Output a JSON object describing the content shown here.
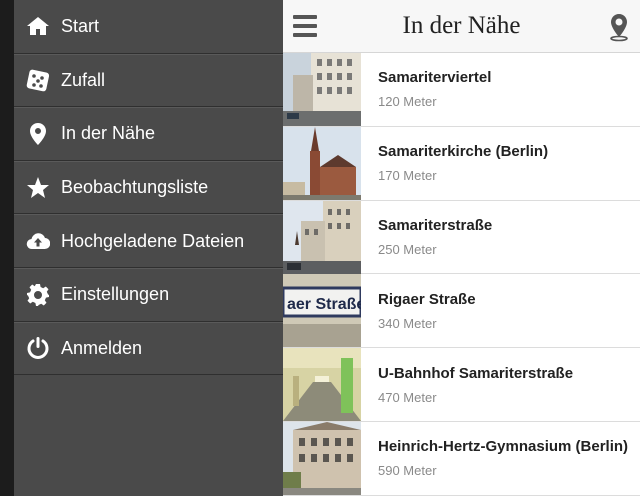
{
  "drawer": {
    "items": [
      {
        "label": "Start",
        "icon": "home-icon"
      },
      {
        "label": "Zufall",
        "icon": "dice-icon"
      },
      {
        "label": "In der Nähe",
        "icon": "location-pin-icon"
      },
      {
        "label": "Beobachtungsliste",
        "icon": "star-icon"
      },
      {
        "label": "Hochgeladene Dateien",
        "icon": "cloud-upload-icon"
      },
      {
        "label": "Einstellungen",
        "icon": "gear-icon"
      },
      {
        "label": "Anmelden",
        "icon": "power-icon"
      }
    ]
  },
  "header": {
    "title": "In der Nähe",
    "menu_icon": "hamburger-icon",
    "action_icon": "location-pin-icon"
  },
  "nearby": [
    {
      "title": "Samariterviertel",
      "distance": "120 Meter"
    },
    {
      "title": "Samariterkirche (Berlin)",
      "distance": "170 Meter"
    },
    {
      "title": "Samariterstraße",
      "distance": "250 Meter"
    },
    {
      "title": "Rigaer Straße",
      "distance": "340 Meter",
      "sign_text": "aer Straße"
    },
    {
      "title": "U-Bahnhof Samariterstraße",
      "distance": "470 Meter"
    },
    {
      "title": "Heinrich-Hertz-Gymnasium (Berlin)",
      "distance": "590 Meter"
    }
  ],
  "colors": {
    "drawer_bg": "#4a4a4a",
    "header_bg": "#f7f7f7",
    "title_text": "#222222",
    "distance_text": "#8a8a8a"
  }
}
